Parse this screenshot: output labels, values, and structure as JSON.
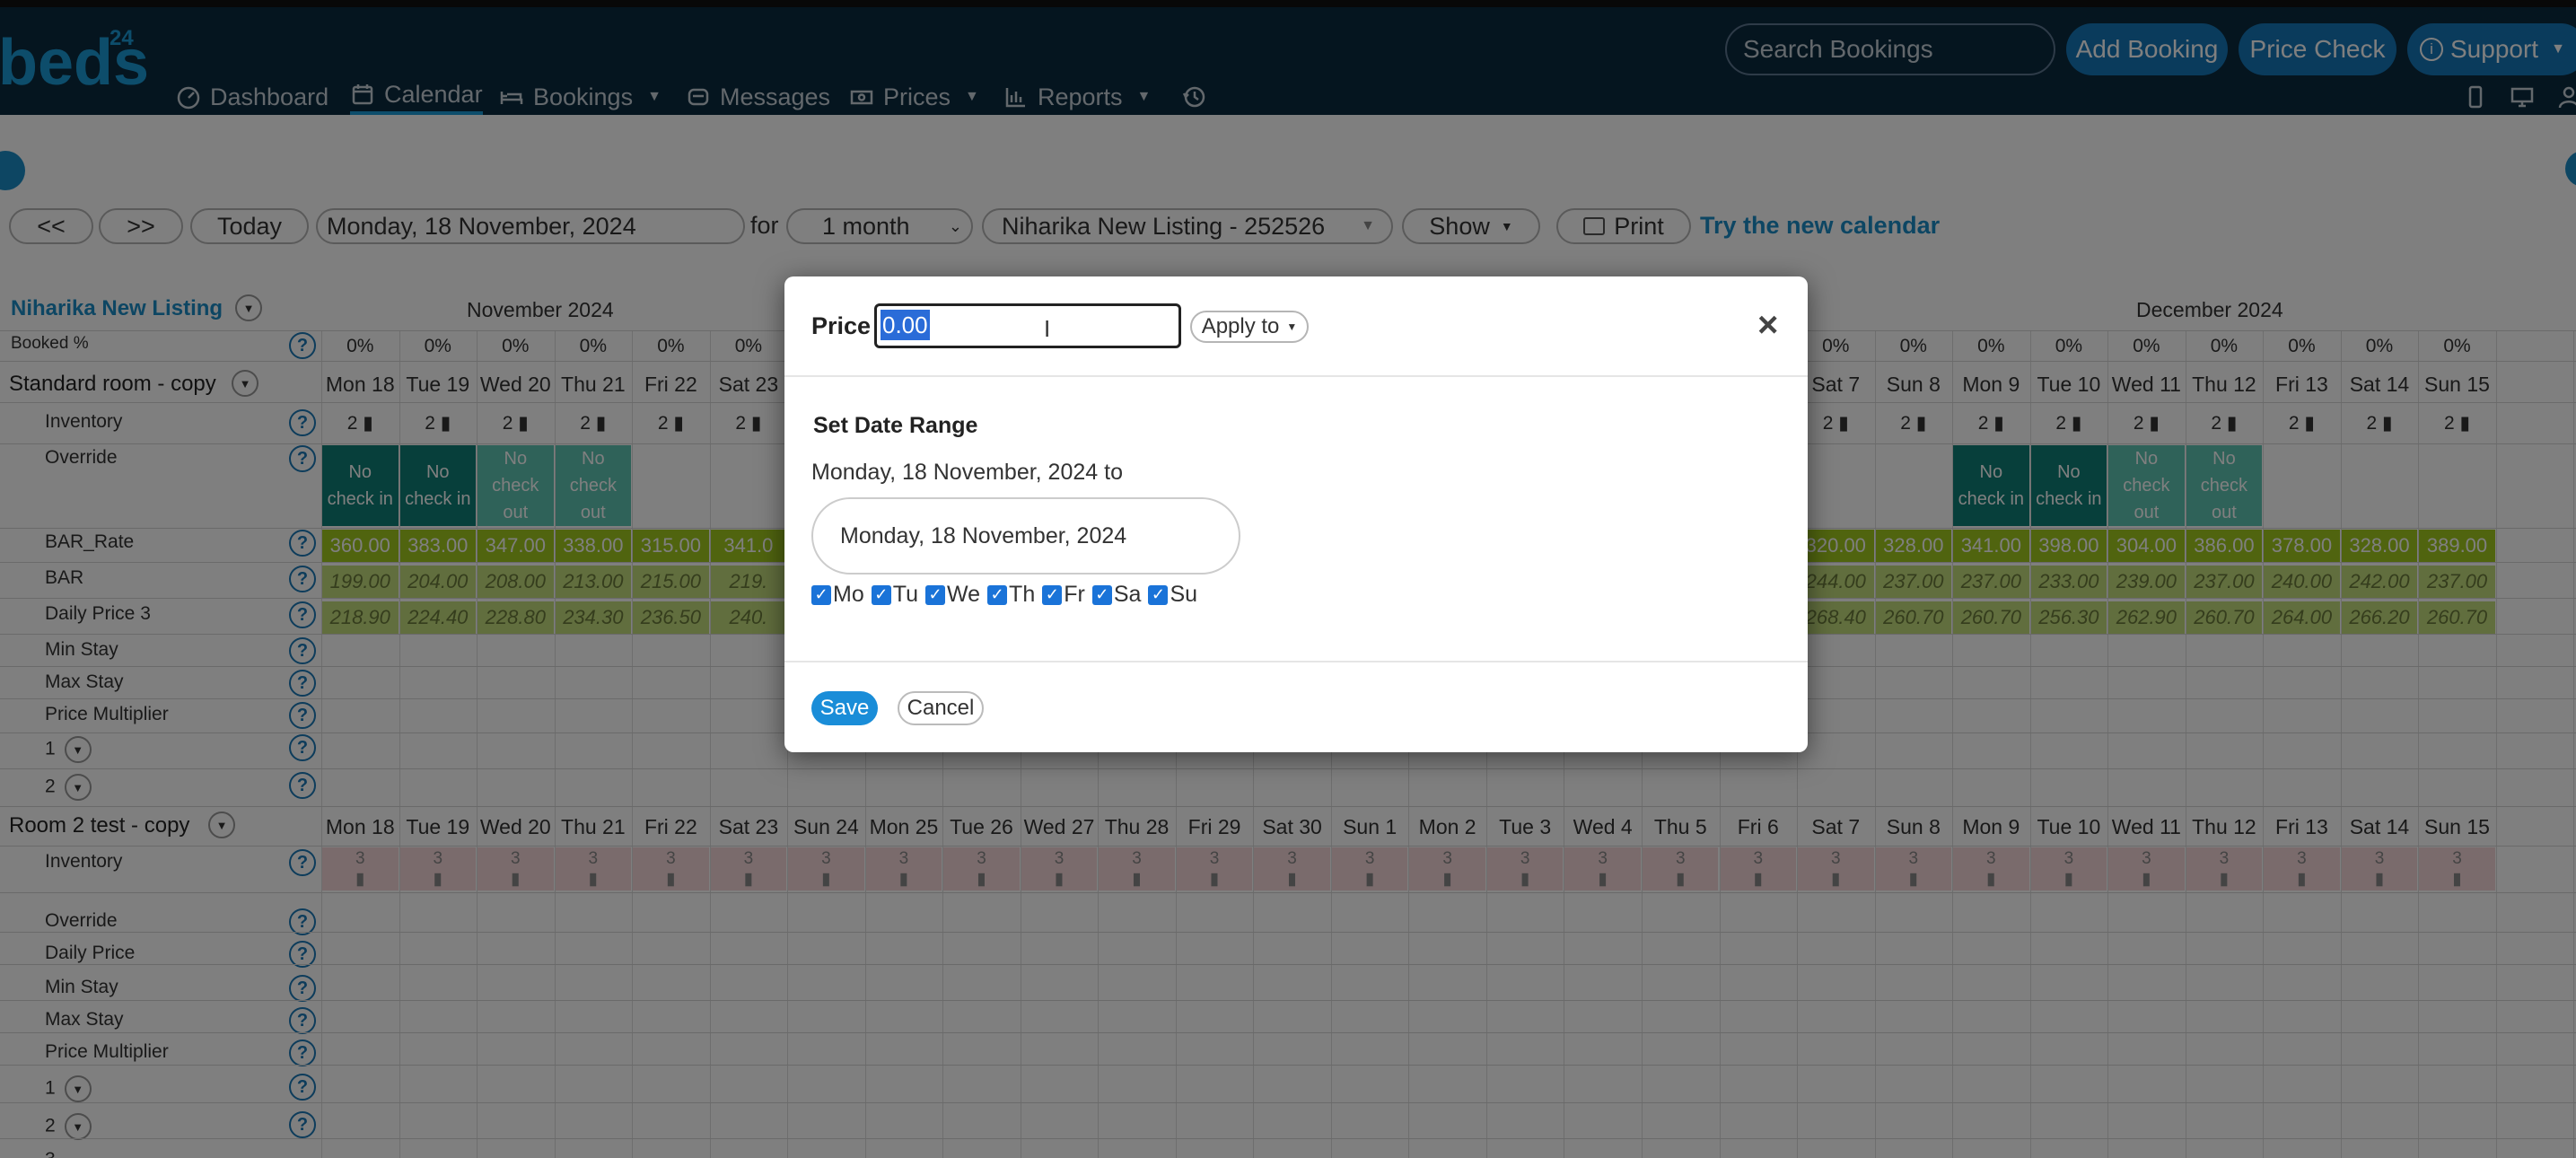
{
  "app": {
    "logo_word": "beds",
    "logo_sup": "24",
    "nav": [
      {
        "key": "dashboard",
        "label": "Dashboard",
        "icon": "dashboard-icon"
      },
      {
        "key": "calendar",
        "label": "Calendar",
        "icon": "calendar-icon",
        "active": true
      },
      {
        "key": "bookings",
        "label": "Bookings",
        "icon": "bed-icon",
        "dropdown": true
      },
      {
        "key": "messages",
        "label": "Messages",
        "icon": "message-icon"
      },
      {
        "key": "prices",
        "label": "Prices",
        "icon": "money-icon",
        "dropdown": true
      },
      {
        "key": "reports",
        "label": "Reports",
        "icon": "chart-icon",
        "dropdown": true
      }
    ],
    "history_icon": "history-icon",
    "search_placeholder": "Search Bookings",
    "add_booking": "Add Booking",
    "price_check": "Price Check",
    "support": "Support"
  },
  "controls": {
    "prev": "<<",
    "next": ">>",
    "today": "Today",
    "date": "Monday, 18 November, 2024",
    "for": "for",
    "period": "1 month",
    "property": "Niharika New Listing - 252526",
    "show": "Show",
    "print": "Print",
    "try_new": "Try the new calendar"
  },
  "calendar": {
    "property_name": "Niharika New Listing",
    "month_nov": "November 2024",
    "month_dec": "December 2024",
    "booked_label": "Booked %",
    "booked_pct": "0%",
    "room1": {
      "name": "Standard room - copy",
      "rows": [
        "Inventory",
        "Override",
        "BAR_Rate",
        "BAR",
        "Daily Price 3",
        "Min Stay",
        "Max Stay",
        "Price Multiplier",
        "1",
        "2"
      ]
    },
    "room2": {
      "name": "Room 2 test - copy",
      "rows": [
        "Inventory",
        "Override",
        "Daily Price",
        "Min Stay",
        "Max Stay",
        "Price Multiplier",
        "1",
        "2",
        "3"
      ]
    },
    "days": [
      "Mon 18",
      "Tue 19",
      "Wed 20",
      "Thu 21",
      "Fri 22",
      "Sat 23",
      "Sun 24",
      "Mon 25",
      "Tue 26",
      "Wed 27",
      "Thu 28",
      "Fri 29",
      "Sat 30",
      "Sun 1",
      "Mon 2",
      "Tue 3",
      "Wed 4",
      "Thu 5",
      "Fri 6",
      "Sat 7",
      "Sun 8",
      "Mon 9",
      "Tue 10",
      "Wed 11",
      "Thu 12",
      "Fri 13",
      "Sat 14",
      "Sun 15"
    ],
    "days_room1_visible_left": [
      "Mon 18",
      "Tue 19",
      "Wed 20",
      "Thu 21",
      "Fri 22",
      "Sat 2"
    ],
    "days_room1_visible_right": [
      "i 6",
      "Sat 7",
      "Sun 8",
      "Mon 9",
      "Tue 10",
      "Wed 11",
      "Thu 12",
      "Fri 13",
      "Sat 14",
      "Sun 15"
    ],
    "inventory_value": "2",
    "inventory_value_room2": "3",
    "override_left": [
      "No check in",
      "No check in",
      "No check out",
      "No check out"
    ],
    "override_right": [
      "No check in",
      "No check in",
      "No check out",
      "No check out"
    ],
    "bar_rate_left": [
      "360.00",
      "383.00",
      "347.00",
      "338.00",
      "315.00",
      "341.0"
    ],
    "bar_rate_right": [
      ".00",
      "320.00",
      "328.00",
      "341.00",
      "398.00",
      "304.00",
      "386.00",
      "378.00",
      "328.00",
      "389.00"
    ],
    "bar_left": [
      "199.00",
      "204.00",
      "208.00",
      "213.00",
      "215.00",
      "219."
    ],
    "bar_right": [
      ".00",
      "244.00",
      "237.00",
      "237.00",
      "233.00",
      "239.00",
      "237.00",
      "240.00",
      "242.00",
      "237.00"
    ],
    "dp3_left": [
      "218.90",
      "224.40",
      "228.80",
      "234.30",
      "236.50",
      "240."
    ],
    "dp3_right": [
      "20",
      "268.40",
      "260.70",
      "260.70",
      "256.30",
      "262.90",
      "260.70",
      "264.00",
      "266.20",
      "260.70"
    ]
  },
  "modal": {
    "price_label": "Price",
    "price_value": "0.00",
    "apply_to": "Apply to",
    "close": "×",
    "section_title": "Set Date Range",
    "from_text": "Monday, 18 November, 2024 to",
    "to_date": "Monday, 18 November, 2024",
    "weekdays": [
      "Mo",
      "Tu",
      "We",
      "Th",
      "Fr",
      "Sa",
      "Su"
    ],
    "save": "Save",
    "cancel": "Cancel"
  },
  "colors": {
    "topbar": "#0b2a3f",
    "accent": "#1576b8",
    "bar_rate": "#a0c81e",
    "bar": "#c3dc7c",
    "override_dark": "#0e7e76",
    "override_light": "#5fc4b3",
    "inventory_room2": "#f4d6d8"
  }
}
